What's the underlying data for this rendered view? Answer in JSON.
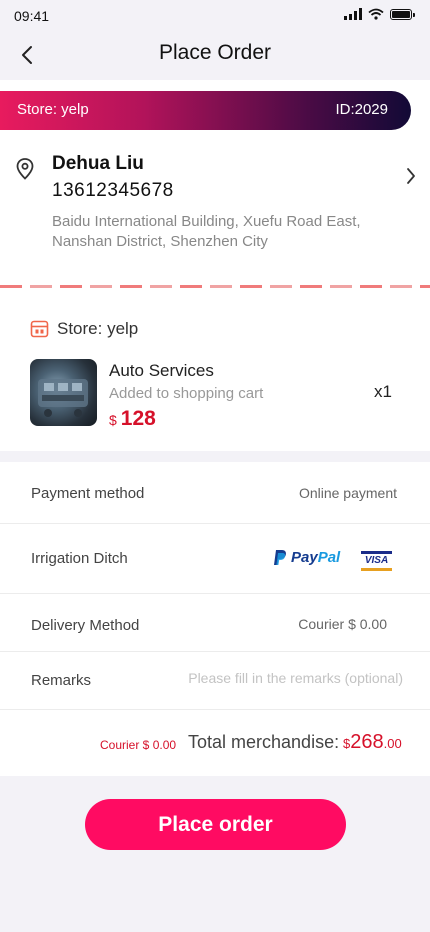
{
  "status_bar": {
    "time": "09:41"
  },
  "nav": {
    "title": "Place Order"
  },
  "banner": {
    "store_label": "Store: yelp",
    "store_id": "ID:2029",
    "gradient_colors": [
      "#e81b5e",
      "#4a0b45",
      "#120a36"
    ]
  },
  "address": {
    "name": "Dehua Liu",
    "phone": "13612345678",
    "line1": "Baidu International Building, Xuefu Road East,",
    "line2": "Nanshan District, Shenzhen City"
  },
  "order": {
    "store_name": "Store: yelp",
    "product": {
      "name": "Auto Services",
      "subtitle": "Added to shopping cart",
      "currency": "$",
      "price": "128",
      "quantity": "x1"
    }
  },
  "details": {
    "payment_label": "Payment method",
    "payment_value": "Online payment",
    "ditch_label": "Irrigation Ditch",
    "paypal_pay": "Pay",
    "paypal_pal": "Pal",
    "visa": "VISA",
    "delivery_label": "Delivery Method",
    "delivery_value": "Courier  $ 0.00",
    "remarks_label": "Remarks",
    "remarks_placeholder": "Please fill in the remarks (optional)"
  },
  "total": {
    "courier": "Courier  $ 0.00",
    "label": "Total merchandise:",
    "currency": "$",
    "amount_int": "268",
    "amount_dec": ".00"
  },
  "actions": {
    "place_order": "Place order"
  },
  "colors": {
    "accent": "#ff0b62",
    "price": "#d6112a",
    "background": "#f3f2f7"
  }
}
